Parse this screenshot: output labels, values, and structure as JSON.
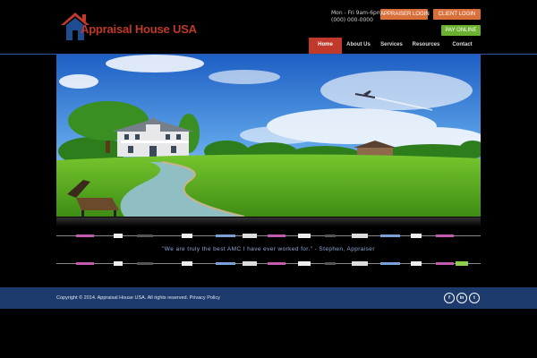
{
  "brand": {
    "name_main": "Appraisal House",
    "name_suffix": "USA",
    "logo_icon": "house-icon",
    "accent": "#c0392b"
  },
  "header": {
    "phone_line_1": "Mon - Fri 9am-6pm",
    "phone_line_2": "(000) 000-0000"
  },
  "header_buttons": {
    "appraiser_login": "APPRAISER LOGIN",
    "client_login": "CLIENT LOGIN",
    "pay_online": "PAY ONLINE"
  },
  "nav": {
    "items": [
      "Home",
      "About Us",
      "Services",
      "Resources",
      "Contact"
    ],
    "active": "Home"
  },
  "hero": {
    "icon": "landscape-house-illustration"
  },
  "testimonial": {
    "text": "\"We are truly the best AMC I have ever worked for.\"  - Stephen, Appraiser"
  },
  "footer": {
    "copyright": "Copyright © 2014. Appraisal House USA. All rights reserved. Privacy Policy",
    "social": [
      "facebook-icon",
      "linkedin-icon",
      "twitter-icon"
    ],
    "social_labels": [
      "f",
      "in",
      "t"
    ]
  },
  "colors": {
    "header_button_orange": "#d9703a",
    "pay_button_green": "#6cb030",
    "footer_blue": "#1c3a6c",
    "nav_rule_blue": "#2e56a6"
  }
}
